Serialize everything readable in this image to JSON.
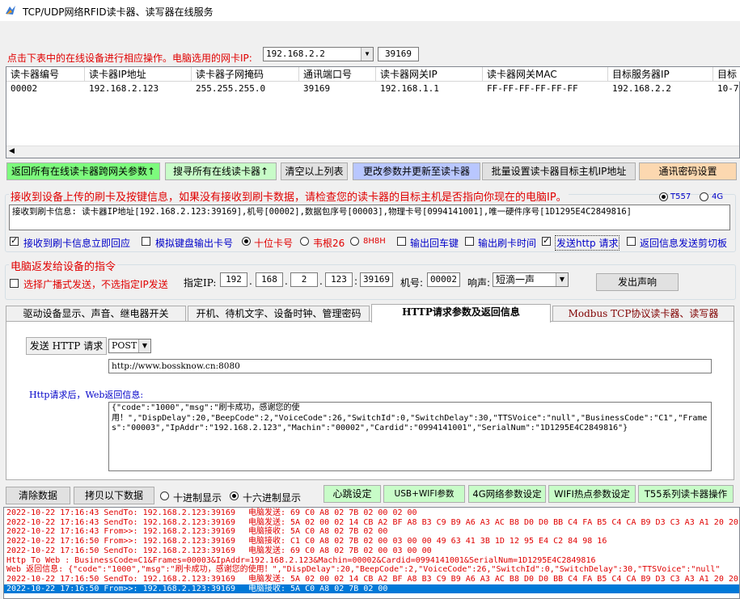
{
  "window": {
    "title": "TCP/UDP网络RFID读卡器、读写器在线服务"
  },
  "nic": {
    "prompt": "点击下表中的在线设备进行相应操作。电脑选用的网卡IP:",
    "ip": "192.168.2.2",
    "port": "39169"
  },
  "table": {
    "columns": [
      "读卡器编号",
      "读卡器IP地址",
      "读卡器子网掩码",
      "通讯端口号",
      "读卡器网关IP",
      "读卡器网关MAC",
      "目标服务器IP",
      "目标"
    ],
    "rows": [
      [
        "00002",
        "192.168.2.123",
        "255.255.255.0",
        "39169",
        "192.168.1.1",
        "FF-FF-FF-FF-FF-FF",
        "192.168.2.2",
        "10-7"
      ]
    ]
  },
  "toolbar": {
    "return_all": "返回所有在线读卡器跨网关参数↑",
    "search_all": "搜寻所有在线读卡器↑",
    "clear_list": "清空以上列表",
    "update_params": "更改参数并更新至读卡器",
    "batch_target": "批量设置读卡器目标主机IP地址",
    "comm_password": "通讯密码设置"
  },
  "recv": {
    "title": "接收到设备上传的刷卡及按键信息，如果没有接收到刷卡数据，请检查您的读卡器的目标主机是否指向你现在的电脑IP。",
    "t557": "T557",
    "g4": "4G",
    "info": "接收到刷卡信息: 读卡器IP地址[192.168.2.123:39169],机号[00002],数据包序号[00003],物理卡号[0994141001],唯一硬件序号[1D1295E4C2849816]",
    "opt_respond": "接收到刷卡信息立即回应",
    "opt_keyboard": "模拟键盘输出卡号",
    "opt_ten": "十位卡号",
    "opt_wiegand": "韦根26",
    "opt_8h8h": "8H8H",
    "opt_output_enter": "输出回车键",
    "opt_output_time": "输出刷卡时间",
    "opt_http": "发送http 请求",
    "opt_clipboard": "返回信息发送剪切板"
  },
  "cmd": {
    "title": "电脑返发给设备的指令",
    "broadcast": "选择广播式发送，不选指定IP发送",
    "ip_label": "指定IP:",
    "ip1": "192",
    "ip2": "168",
    "ip3": "2",
    "ip4": "123",
    "port": "39169",
    "machine_label": "机号:",
    "machine": "00002",
    "sound_label": "响声:",
    "sound": "短滴一声",
    "beep_button": "发出声响"
  },
  "tabs": [
    "驱动设备显示、声音、继电器开关",
    "开机、待机文字、设备时钟、管理密码",
    "HTTP请求参数及返回信息",
    "Modbus TCP协议读卡器、读写器"
  ],
  "http": {
    "send_button": "发送 HTTP 请求",
    "method": "POST",
    "url": "http://www.bossknow.cn:8080",
    "return_label": "Http请求后，Web返回信息:",
    "response_line1": "{\"code\":\"1000\",\"msg\":\"刷卡成功，感谢您的使",
    "response_line2": "用！\",\"DispDelay\":20,\"BeepCode\":2,\"VoiceCode\":26,\"SwitchId\":0,\"SwitchDelay\":30,\"TTSVoice\":\"null\",\"BusinessCode\":\"C1\",\"Frame",
    "response_line3": "s\":\"00003\",\"IpAddr\":\"192.168.2.123\",\"Machin\":\"00002\",\"Cardid\":\"0994141001\",\"SerialNum\":\"1D1295E4C2849816\"}"
  },
  "bottom": {
    "clear_data": "清除数据",
    "copy_data": "拷贝以下数据",
    "decimal": "十进制显示",
    "hex": "十六进制显示",
    "heartbeat": "心跳设定",
    "usb_wifi": "USB+WIFI参数",
    "g4_net": "4G网络参数设定",
    "wifi_hotspot": "WIFI热点参数设定",
    "t55": "T55系列读卡器操作"
  },
  "log": [
    {
      "a": "2022-10-22 17:16:43 SendTo: 192.168.2.123:39169",
      "b": "电脑发送: 69 C0 A8 02 7B 02 00 02 00",
      "color": "#e00000"
    },
    {
      "a": "2022-10-22 17:16:43 SendTo: 192.168.2.123:39169",
      "b": "电脑发送: 5A 02 00 02 14 CB A2 BF A8 B3 C9 B9 A6 A3 AC B8 D0 D0 BB C4 FA B5 C4 CA B9 D3 C3 A3 A1 20 20",
      "color": "#e00000"
    },
    {
      "a": "2022-10-22 17:16:43 From>>: 192.168.2.123:39169",
      "b": "电脑接收: 5A C0 A8 02 7B 02 00",
      "color": "#e00000"
    },
    {
      "a": "2022-10-22 17:16:50 From>>: 192.168.2.123:39169",
      "b": "电脑接收: C1 C0 A8 02 7B 02 00 03 00 00 49 63 41 3B 1D 12 95 E4 C2 84 98 16",
      "color": "#e00000"
    },
    {
      "a": "2022-10-22 17:16:50 SendTo: 192.168.2.123:39169",
      "b": "电脑发送: 69 C0 A8 02 7B 02 00 03 00 00",
      "color": "#e00000"
    },
    {
      "a": "Http To Web : BusinessCode=C1&Frames=00003&IpAddr=192.168.2.123&Machin=00002&Cardid=0994141001&SerialNum=1D1295E4C2849816",
      "b": "",
      "color": "#e00000"
    },
    {
      "a": "Web 返回信息: {\"code\":\"1000\",\"msg\":\"刷卡成功，感谢您的使用！\",\"DispDelay\":20,\"BeepCode\":2,\"VoiceCode\":26,\"SwitchId\":0,\"SwitchDelay\":30,\"TTSVoice\":\"null\"",
      "b": "",
      "color": "#e00000"
    },
    {
      "a": "2022-10-22 17:16:50 SendTo: 192.168.2.123:39169",
      "b": "电脑发送: 5A 02 00 02 14 CB A2 BF A8 B3 C9 B9 A6 A3 AC B8 D0 D0 BB C4 FA B5 C4 CA B9 D3 C3 A3 A1 20 20",
      "color": "#e00000"
    },
    {
      "a": "2022-10-22 17:16:50 From>>: 192.168.2.123:39169",
      "b": "电脑接收: 5A C0 A8 02 7B 02 00",
      "color": "#ffffff"
    }
  ],
  "colors": {
    "selected_row": "#0078d7",
    "accent_red": "#e00000",
    "accent_blue": "#0000c8"
  }
}
